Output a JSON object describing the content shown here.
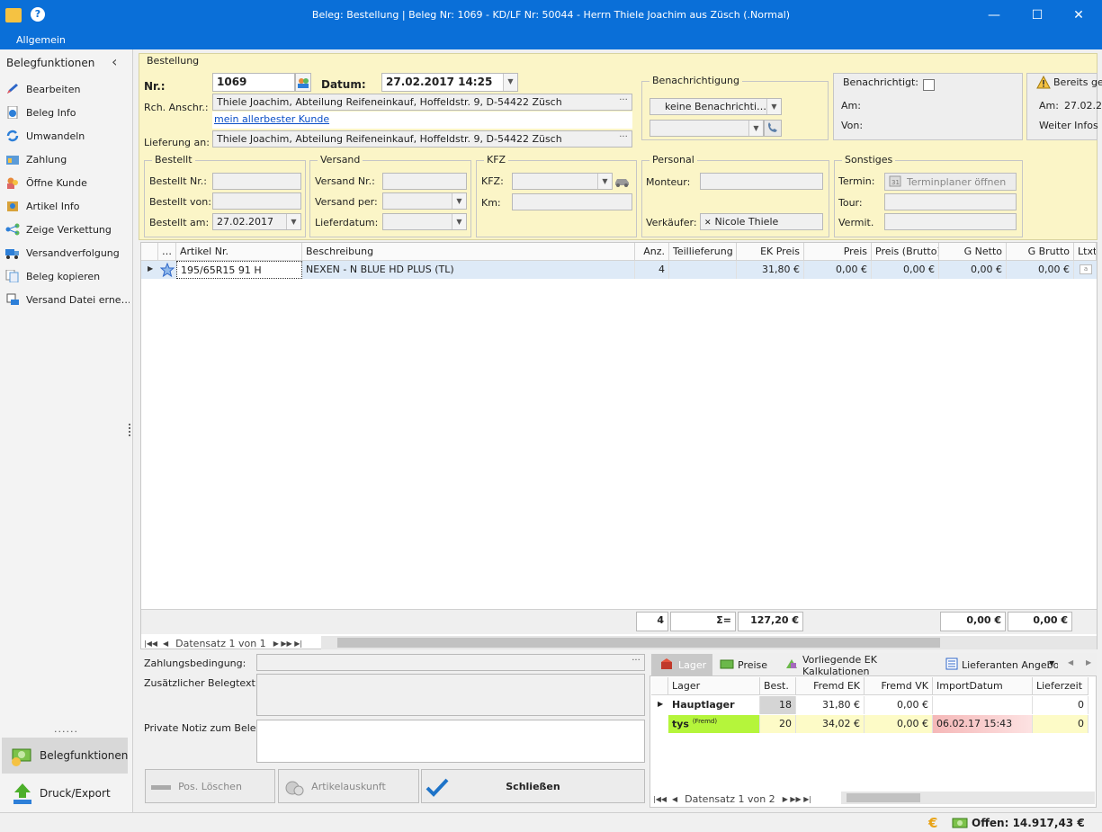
{
  "window": {
    "title": "Beleg: Bestellung | Beleg Nr: 1069 -  KD/LF Nr: 50044 - Herrn Thiele Joachim aus Züsch (.Normal)",
    "minimize": "—",
    "maximize": "☐",
    "close": "✕",
    "menu_item": "Allgemein"
  },
  "sidebar": {
    "header": "Belegfunktionen",
    "collapse_icon": "‹",
    "items": [
      {
        "label": "Bearbeiten",
        "icon": "pencil-icon"
      },
      {
        "label": "Beleg Info",
        "icon": "info-icon"
      },
      {
        "label": "Umwandeln",
        "icon": "convert-icon"
      },
      {
        "label": "Zahlung",
        "icon": "payment-icon"
      },
      {
        "label": "Öffne Kunde",
        "icon": "customer-icon"
      },
      {
        "label": "Artikel Info",
        "icon": "article-icon"
      },
      {
        "label": "Zeige Verkettung",
        "icon": "chain-icon"
      },
      {
        "label": "Versandverfolgung",
        "icon": "truck-icon"
      },
      {
        "label": "Beleg kopieren",
        "icon": "copy-icon"
      },
      {
        "label": "Versand Datei erne…",
        "icon": "ship-file-icon"
      }
    ],
    "dots": "......",
    "bottom_buttons": [
      {
        "label": "Belegfunktionen",
        "icon": "money-icon"
      },
      {
        "label": "Druck/Export",
        "icon": "upload-icon"
      }
    ]
  },
  "bestellung": {
    "group_title": "Bestellung",
    "nr_label": "Nr.:",
    "nr_value": "1069",
    "datum_label": "Datum:",
    "datum_value": "27.02.2017 14:25",
    "rch_label": "Rch. Anschr.:",
    "rch_value": "Thiele Joachim, Abteilung Reifeneinkauf, Hoffeldstr. 9,  D-54422 Züsch",
    "kunde_link": "mein allerbester Kunde",
    "lieferung_label": "Lieferung an:",
    "lieferung_value": "Thiele Joachim, Abteilung Reifeneinkauf, Hoffeldstr. 9,  D-54422 Züsch",
    "ellipsis": "···"
  },
  "benachrichtigung": {
    "title": "Benachrichtigung",
    "select_value": "keine Benachrichti…"
  },
  "benachrichtigt": {
    "title": "Benachrichtigt:",
    "am": "Am:",
    "von": "Von:"
  },
  "bereits": {
    "title": "Bereits ge",
    "am": "Am:",
    "am_value": "27.02.2",
    "weiter": "Weiter Infos i"
  },
  "bestellt": {
    "title": "Bestellt",
    "nr": "Bestellt Nr.:",
    "von": "Bestellt von:",
    "am": "Bestellt am:",
    "am_value": "27.02.2017"
  },
  "versand": {
    "title": "Versand",
    "nr": "Versand Nr.:",
    "per": "Versand per:",
    "datum": "Lieferdatum:"
  },
  "kfz": {
    "title": "KFZ",
    "kfz": "KFZ:",
    "km": "Km:"
  },
  "personal": {
    "title": "Personal",
    "monteur": "Monteur:",
    "verkaeufer": "Verkäufer:",
    "verkaeufer_value": "Nicole Thiele",
    "x": "✕"
  },
  "sonstiges": {
    "title": "Sonstiges",
    "termin": "Termin:",
    "termin_button": "Terminplaner öffnen",
    "tour": "Tour:",
    "vermit": "Vermit."
  },
  "positions": {
    "headers": [
      "…",
      "Artikel Nr.",
      "Beschreibung",
      "Anz.",
      "Teillieferung",
      "EK Preis",
      "Preis",
      "Preis (Brutto)",
      "G Netto",
      "G Brutto",
      "Ltxt"
    ],
    "rows": [
      {
        "artikel": "195/65R15 91 H",
        "beschreibung": "NEXEN - N BLUE HD PLUS (TL)",
        "anz": "4",
        "teil": "",
        "ek": "31,80 €",
        "preis": "0,00 €",
        "brutto": "0,00 €",
        "gnetto": "0,00 €",
        "gbrutto": "0,00 €"
      }
    ],
    "totals": {
      "anz": "4",
      "sigma": "Σ=",
      "ek": "127,20 €",
      "gnetto": "0,00 €",
      "gbrutto": "0,00 €"
    },
    "nav": "Datensatz 1 von 1"
  },
  "bottom": {
    "zahlung": "Zahlungsbedingung:",
    "zusatz": "Zusätzlicher Belegtext:",
    "notiz": "Private Notiz zum Beleg:",
    "btn_loeschen": "Pos. Löschen",
    "btn_artikel": "Artikelauskunft",
    "btn_schliessen": "Schließen"
  },
  "lager": {
    "tabs": [
      "Lager",
      "Preise",
      "Vorliegende EK Kalkulationen",
      "Lieferanten Angebo"
    ],
    "headers": [
      "Lager",
      "Best.",
      "Fremd EK",
      "Fremd VK",
      "ImportDatum",
      "Lieferzeit"
    ],
    "rows": [
      {
        "lager": "Hauptlager",
        "tag": "",
        "best": "18",
        "ek": "31,80 €",
        "vk": "0,00 €",
        "datum": "",
        "lz": "0"
      },
      {
        "lager": "tys",
        "tag": "(Fremd)",
        "best": "20",
        "ek": "34,02 €",
        "vk": "0,00 €",
        "datum": "06.02.17 15:43",
        "lz": "0"
      }
    ],
    "nav": "Datensatz 1 von 2"
  },
  "status": {
    "offen": "Offen: 14.917,43 €"
  },
  "colors": {
    "accent": "#0a6fd8",
    "form_yellow": "#fbf5c7",
    "row_green": "#b5f53b",
    "row_yellow": "#fdfbc7",
    "row_red": "#f5b8b8"
  }
}
